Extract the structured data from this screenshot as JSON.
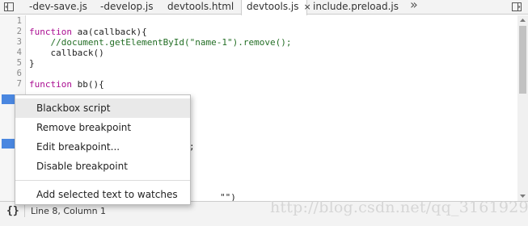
{
  "tabs": [
    {
      "label": "-dev-save.js"
    },
    {
      "label": "-develop.js"
    },
    {
      "label": "devtools.html"
    },
    {
      "label": "devtools.js",
      "active": true,
      "close": "×"
    },
    {
      "label": "include.preload.js"
    }
  ],
  "tabbar": {
    "overflow": "»",
    "left_nav_icon": "sidebar-toggle-icon",
    "right_nav_icon": "panel-toggle-icon"
  },
  "editor": {
    "line_numbers": [
      "1",
      "2",
      "3",
      "4",
      "5",
      "6",
      "7"
    ],
    "partial_line_numbers": [
      "1",
      "1",
      "1"
    ],
    "code": {
      "l2_kw": "function",
      "l2_rest": " aa(callback){",
      "l3": "    //document.getElementById(\"name-1\").remove();",
      "l4": "    callback()",
      "l5": "}",
      "l7_kw": "function",
      "l7_rest": " bb(){",
      "frag_a": ";",
      "frag_b": "\"\")"
    },
    "breakpoint_color": "#4a87e0"
  },
  "context_menu": {
    "items": [
      "Blackbox script",
      "Remove breakpoint",
      "Edit breakpoint...",
      "Disable breakpoint",
      "Add selected text to watches"
    ]
  },
  "statusbar": {
    "pretty_print": "{}",
    "position": "Line 8, Column 1"
  },
  "watermark": "http://blog.csdn.net/qq_31619295"
}
